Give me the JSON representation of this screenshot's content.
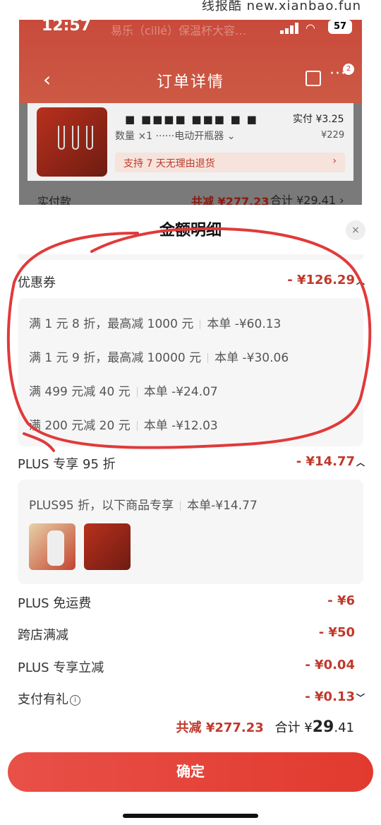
{
  "overlay": {
    "text": "线报酷 new.xianbao.fun"
  },
  "status_bar": {
    "time": "12:57",
    "battery": "57",
    "ghost_text": "易乐（cillé）保温杯大容…"
  },
  "header": {
    "title": "订单详情",
    "back_icon": "chevron-left-icon",
    "badge_count": "2"
  },
  "product": {
    "name": "■ ■■■■ ■■■ ■ ■",
    "qty_text": "数量 ×1  ······电动开瓶器 ⌄",
    "paid_label": "实付 ¥3.25",
    "orig_price": "¥229",
    "refund_text": "支持 7 天无理由退货",
    "refund_arrow": "›"
  },
  "paid_row": {
    "label": "实付款",
    "discount": "共减 ¥277.23",
    "total": "合计 ¥29.41 ›"
  },
  "sheet": {
    "title": "金额明细",
    "close": "×",
    "coupon_section": {
      "label": "优惠券",
      "value": "- ¥126.29"
    },
    "coupons": [
      {
        "desc": "满 1 元 8 折，最高减 1000 元",
        "amount": "本单 -¥60.13"
      },
      {
        "desc": "满 1 元 9 折，最高减 10000 元",
        "amount": "本单 -¥30.06"
      },
      {
        "desc": "满 499 元减 40 元",
        "amount": "本单 -¥24.07"
      },
      {
        "desc": "满 200 元减 20 元",
        "amount": "本单 -¥12.03"
      }
    ],
    "plus_section": {
      "label": "PLUS 专享 95 折",
      "value": "- ¥14.77"
    },
    "plus_detail": {
      "desc": "PLUS95 折，以下商品专享",
      "amount": "本单-¥14.77"
    },
    "rows": [
      {
        "label": "PLUS 免运费",
        "value": "- ¥6"
      },
      {
        "label": "跨店满减",
        "value": "- ¥50"
      },
      {
        "label": "PLUS 专享立减",
        "value": "- ¥0.04"
      },
      {
        "label": "支付有礼",
        "value": "- ¥0.13"
      }
    ]
  },
  "footer": {
    "discount": "共减 ¥277.23",
    "total_prefix": "合计 ¥",
    "total_int": "29",
    "total_dec": ".41",
    "confirm": "确定"
  },
  "colors": {
    "accent": "#e23a2e",
    "discount_red": "#c0392b",
    "annotation": "#e03a3a"
  }
}
